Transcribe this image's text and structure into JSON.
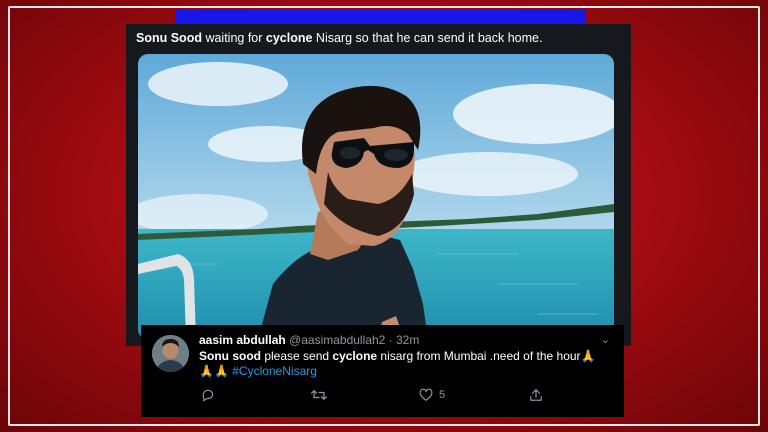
{
  "tweet": {
    "author_bold": "Sonu Sood",
    "text_part1": " waiting for ",
    "keyword": "cyclone",
    "text_part2": " Nisarg so that he can send it back home."
  },
  "reply": {
    "name": "aasim abdullah",
    "handle": "@aasimabdullah2",
    "separator": " · ",
    "time": "32m",
    "text_bold": "Sonu sood",
    "text_part1": " please send ",
    "keyword": "cyclone",
    "text_part2": " nisarg from Mumbai .need of the hour",
    "emoji_inline": "🙏",
    "emoji_line": "🙏🙏",
    "hashtag": "#CycloneNisarg",
    "like_count": "5",
    "caret": "⌄"
  },
  "icons": {
    "reply": "reply-icon",
    "retweet": "retweet-icon",
    "like": "heart-icon",
    "share": "share-icon"
  },
  "colors": {
    "background_red": "#c8101a",
    "blue_strip": "#1818e8",
    "card": "#15181c",
    "hashtag": "#1d9bf0",
    "muted": "#8b98a5"
  }
}
